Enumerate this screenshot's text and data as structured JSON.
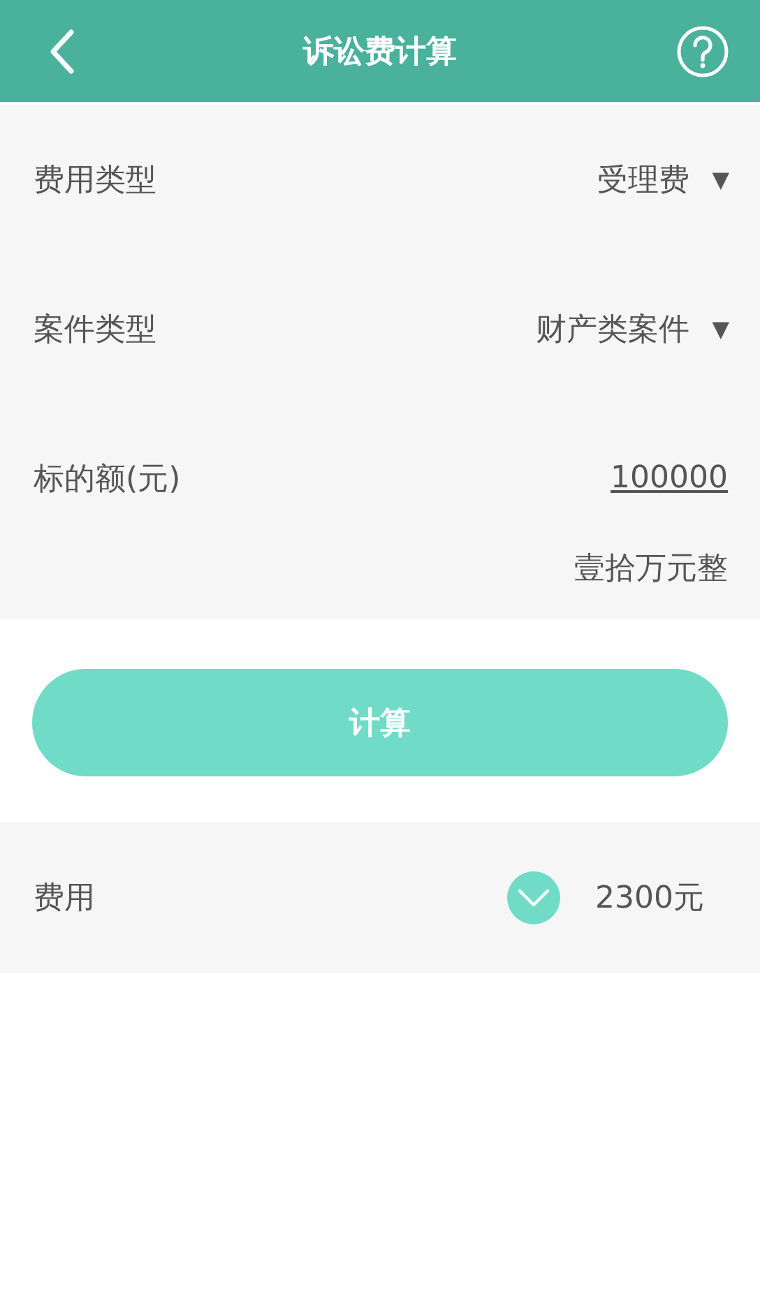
{
  "header": {
    "title": "诉讼费计算"
  },
  "form": {
    "rows": [
      {
        "kind": "select",
        "label": "费用类型",
        "value": "受理费",
        "caret": "▼"
      },
      {
        "kind": "select",
        "label": "案件类型",
        "value": "财产类案件",
        "caret": "▼"
      },
      {
        "kind": "input",
        "label": "标的额(元)",
        "value": "100000"
      }
    ],
    "amount_in_words": "壹拾万元整"
  },
  "calculate_button": "计算",
  "result": {
    "label": "费用",
    "value": "2300元"
  }
}
